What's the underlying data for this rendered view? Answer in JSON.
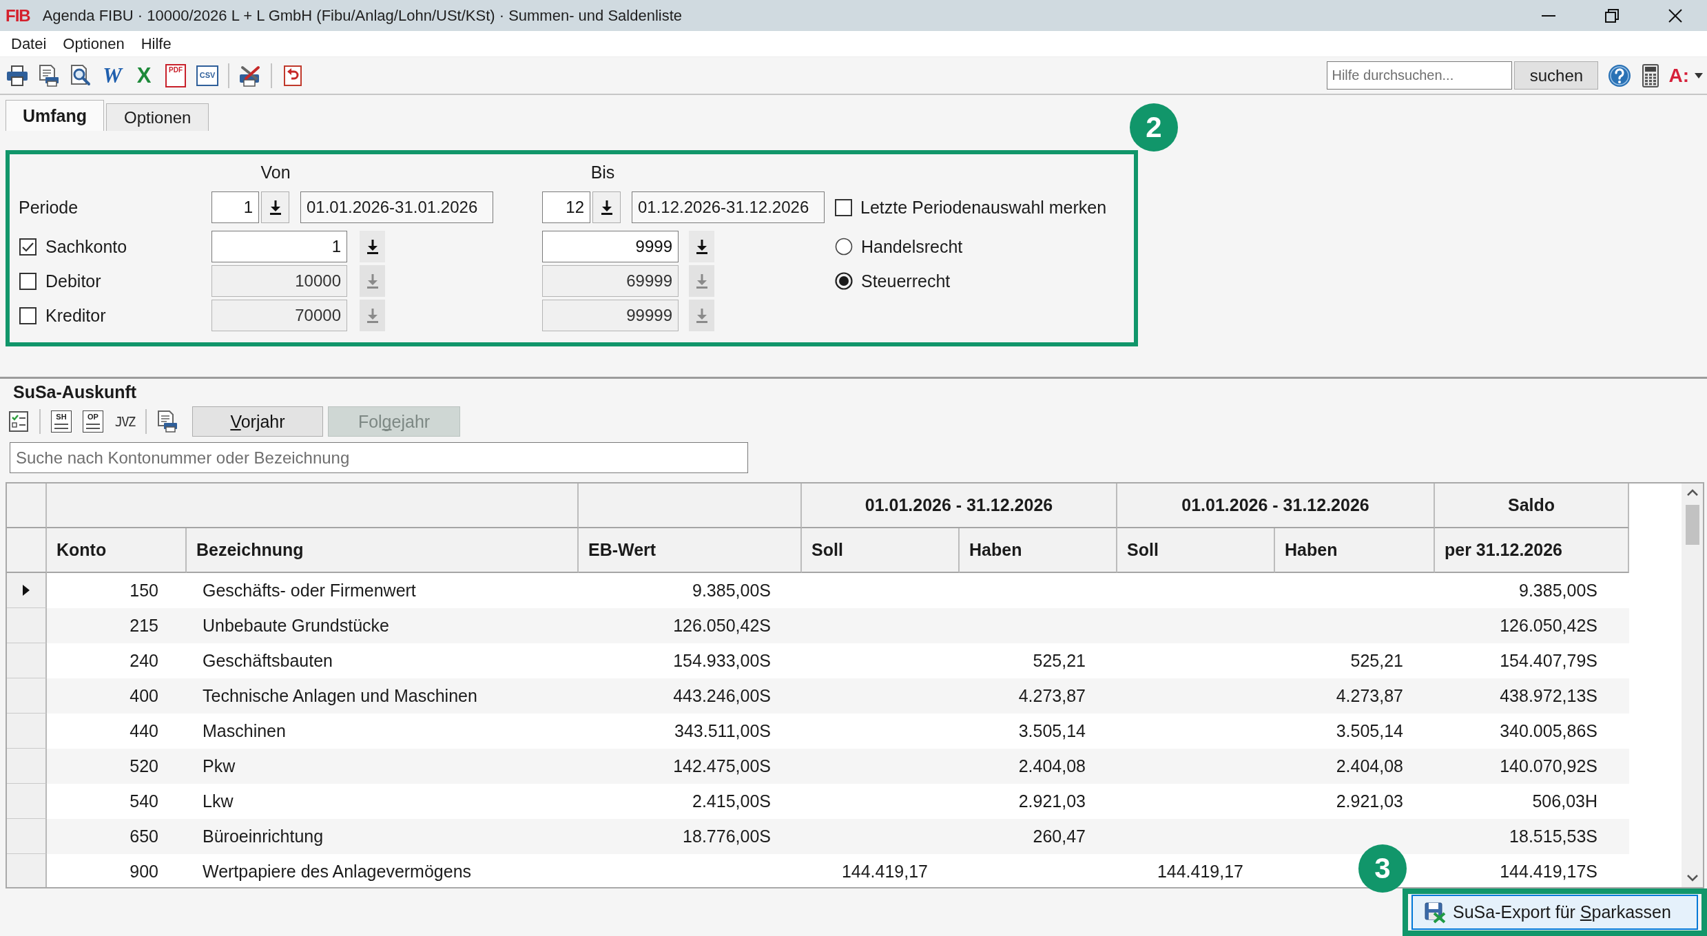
{
  "window": {
    "logo": "FIB",
    "title": "Agenda FIBU · 10000/2026 L + L GmbH (Fibu/Anlag/Lohn/USt/KSt) · Summen- und Saldenliste"
  },
  "menu": [
    "Datei",
    "Optionen",
    "Hilfe"
  ],
  "toolbar": {
    "tools": [
      {
        "kind": "print"
      },
      {
        "kind": "print_list"
      },
      {
        "kind": "preview"
      },
      {
        "kind": "word",
        "glyph": "W"
      },
      {
        "kind": "excel",
        "glyph": "X"
      },
      {
        "kind": "pdf",
        "glyph": "PDF"
      },
      {
        "kind": "csv",
        "glyph": "CSV"
      },
      {
        "kind": "separator"
      },
      {
        "kind": "tools"
      },
      {
        "kind": "separator"
      },
      {
        "kind": "undo"
      }
    ],
    "help_search": {
      "placeholder": "Hilfe durchsuchen...",
      "button": "suchen"
    },
    "app_menu": "A:"
  },
  "tabs": [
    {
      "label": "Umfang",
      "selected": true
    },
    {
      "label": "Optionen",
      "selected": false
    }
  ],
  "scope_panel": {
    "callout": "2",
    "from_heading": "Von",
    "to_heading": "Bis",
    "period": {
      "label": "Periode",
      "from": {
        "value": "1",
        "range": "01.01.2026-31.01.2026"
      },
      "to": {
        "value": "12",
        "range": "01.12.2026-31.12.2026"
      }
    },
    "accounts": [
      {
        "label": "Sachkonto",
        "checked": true,
        "from": "1",
        "to": "9999"
      },
      {
        "label": "Debitor",
        "checked": false,
        "from": "10000",
        "to": "69999"
      },
      {
        "label": "Kreditor",
        "checked": false,
        "from": "70000",
        "to": "99999"
      }
    ],
    "remember_period": {
      "label": "Letzte Periodenauswahl merken",
      "checked": false
    },
    "law": [
      {
        "label": "Handelsrecht",
        "selected": false
      },
      {
        "label": "Steuerrecht",
        "selected": true
      }
    ]
  },
  "susa": {
    "title": "SuSa-Auskunft",
    "tools": [
      {
        "kind": "checklist"
      },
      {
        "kind": "separator"
      },
      {
        "kind": "grid",
        "glyph": "SH"
      },
      {
        "kind": "grid",
        "glyph": "OP"
      },
      {
        "kind": "text",
        "glyph": "JVZ"
      },
      {
        "kind": "separator"
      },
      {
        "kind": "print_list"
      }
    ],
    "year_buttons": [
      {
        "access_key": "V",
        "after": "orjahr",
        "disabled": false
      },
      {
        "before": "Fol",
        "access_key": "g",
        "after": "ejahr",
        "disabled": true
      }
    ],
    "search": {
      "placeholder": "Suche nach Kontonummer oder Bezeichnung"
    },
    "table": {
      "column_groups": [
        {
          "columns": [
            {
              "label": "Konto"
            },
            {
              "label": "Bezeichnung"
            }
          ]
        },
        {
          "columns": [
            {
              "label": "EB-Wert"
            }
          ]
        },
        {
          "label": "01.01.2026 - 31.12.2026",
          "columns": [
            {
              "label": "Soll"
            },
            {
              "label": "Haben"
            }
          ]
        },
        {
          "label": "01.01.2026 - 31.12.2026",
          "columns": [
            {
              "label": "Soll"
            },
            {
              "label": "Haben"
            }
          ]
        },
        {
          "label": "Saldo",
          "columns": [
            {
              "label": "per 31.12.2026"
            }
          ]
        }
      ],
      "rows": [
        {
          "selected": true,
          "konto": "150",
          "bezeichnung": "Geschäfts- oder Firmenwert",
          "eb_wert": "9.385,00S",
          "saldo": "9.385,00S"
        },
        {
          "selected": false,
          "konto": "215",
          "bezeichnung": "Unbebaute Grundstücke",
          "eb_wert": "126.050,42S",
          "saldo": "126.050,42S"
        },
        {
          "selected": false,
          "konto": "240",
          "bezeichnung": "Geschäftsbauten",
          "eb_wert": "154.933,00S",
          "haben_1": "525,21",
          "haben_2": "525,21",
          "saldo": "154.407,79S"
        },
        {
          "selected": false,
          "konto": "400",
          "bezeichnung": "Technische Anlagen und Maschinen",
          "eb_wert": "443.246,00S",
          "haben_1": "4.273,87",
          "haben_2": "4.273,87",
          "saldo": "438.972,13S"
        },
        {
          "selected": false,
          "konto": "440",
          "bezeichnung": "Maschinen",
          "eb_wert": "343.511,00S",
          "haben_1": "3.505,14",
          "haben_2": "3.505,14",
          "saldo": "340.005,86S"
        },
        {
          "selected": false,
          "konto": "520",
          "bezeichnung": "Pkw",
          "eb_wert": "142.475,00S",
          "haben_1": "2.404,08",
          "haben_2": "2.404,08",
          "saldo": "140.070,92S"
        },
        {
          "selected": false,
          "konto": "540",
          "bezeichnung": "Lkw",
          "eb_wert": "2.415,00S",
          "haben_1": "2.921,03",
          "haben_2": "2.921,03",
          "saldo": "506,03H"
        },
        {
          "selected": false,
          "konto": "650",
          "bezeichnung": "Büroeinrichtung",
          "eb_wert": "18.776,00S",
          "haben_1": "260,47",
          "saldo": "18.515,53S"
        },
        {
          "selected": false,
          "konto": "900",
          "bezeichnung": "Wertpapiere des Anlagevermögens",
          "soll_1": "144.419,17",
          "soll_2": "144.419,17",
          "saldo": "144.419,17S"
        }
      ]
    }
  },
  "export_button": {
    "before": "SuSa-Export für ",
    "access_key": "S",
    "after": "parkassen",
    "callout": "3"
  }
}
